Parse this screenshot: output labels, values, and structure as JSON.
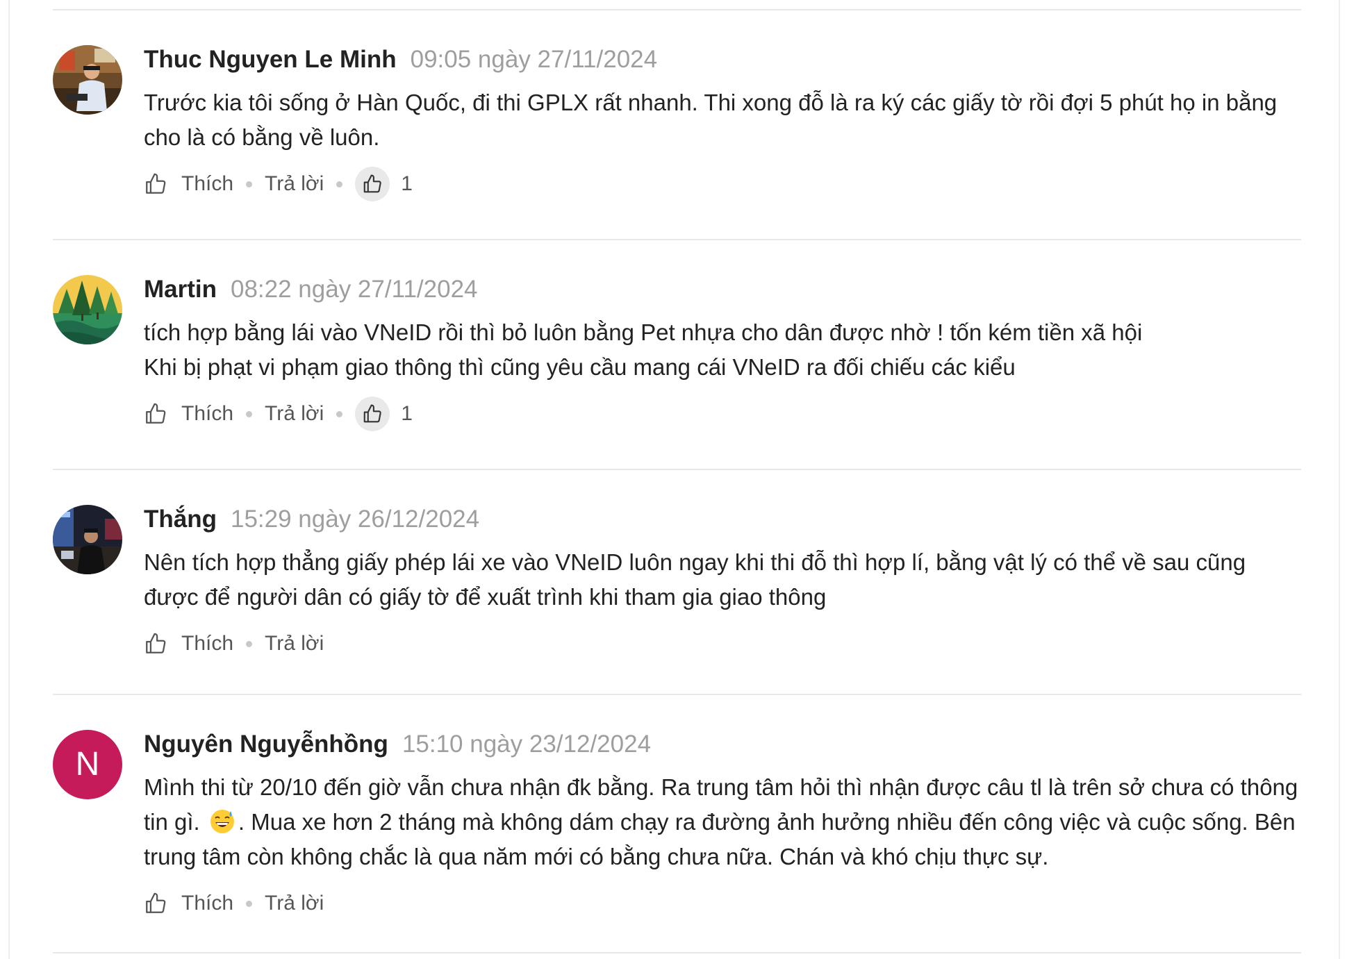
{
  "comments": [
    {
      "author": "Thuc Nguyen Le Minh",
      "time": "09:05 ngày 27/11/2024",
      "text": "Trước kia tôi sống ở Hàn Quốc, đi thi GPLX rất nhanh. Thi xong đỗ là ra ký các giấy tờ rồi đợi 5 phút họ in bằng cho là có bằng về luôn.",
      "like_label": "Thích",
      "reply_label": "Trả lời",
      "reaction_count": "1"
    },
    {
      "author": "Martin",
      "time": "08:22 ngày 27/11/2024",
      "text_line1": "tích hợp bằng lái vào VNeID rồi thì bỏ luôn bằng Pet nhựa cho dân được nhờ ! tốn kém tiền xã hội",
      "text_line2": "Khi bị phạt vi phạm giao thông thì cũng yêu cầu mang cái VNeID ra đối chiếu các kiểu",
      "like_label": "Thích",
      "reply_label": "Trả lời",
      "reaction_count": "1"
    },
    {
      "author": "Thắng",
      "time": "15:29 ngày 26/12/2024",
      "text": "Nên tích hợp thẳng giấy phép lái xe vào VNeID luôn ngay khi thi đỗ thì hợp lí, bằng vật lý có thể về sau cũng được để người dân có giấy tờ để xuất trình khi tham gia giao thông",
      "like_label": "Thích",
      "reply_label": "Trả lời"
    },
    {
      "author": "Nguyên Nguyễnhồng",
      "avatar_letter": "N",
      "time": "15:10 ngày 23/12/2024",
      "text_part1": "Mình thi từ 20/10 đến giờ vẫn chưa nhận đk bằng. Ra trung tâm hỏi thì nhận được câu tl là trên sở chưa có thông tin gì.",
      "emoji": "grinning-sweat-emoji",
      "text_part2": ". Mua xe hơn 2 tháng mà không dám chạy ra đường ảnh hưởng nhiều đến công việc và cuộc sống. Bên trung tâm còn không chắc là qua năm mới có bằng chưa nữa. Chán và khó chịu thực sự.",
      "like_label": "Thích",
      "reply_label": "Trả lời"
    }
  ],
  "colors": {
    "avatar_n_bg": "#c51b5b",
    "time_gray": "#9e9e9e",
    "divider": "#e8e8e8"
  }
}
